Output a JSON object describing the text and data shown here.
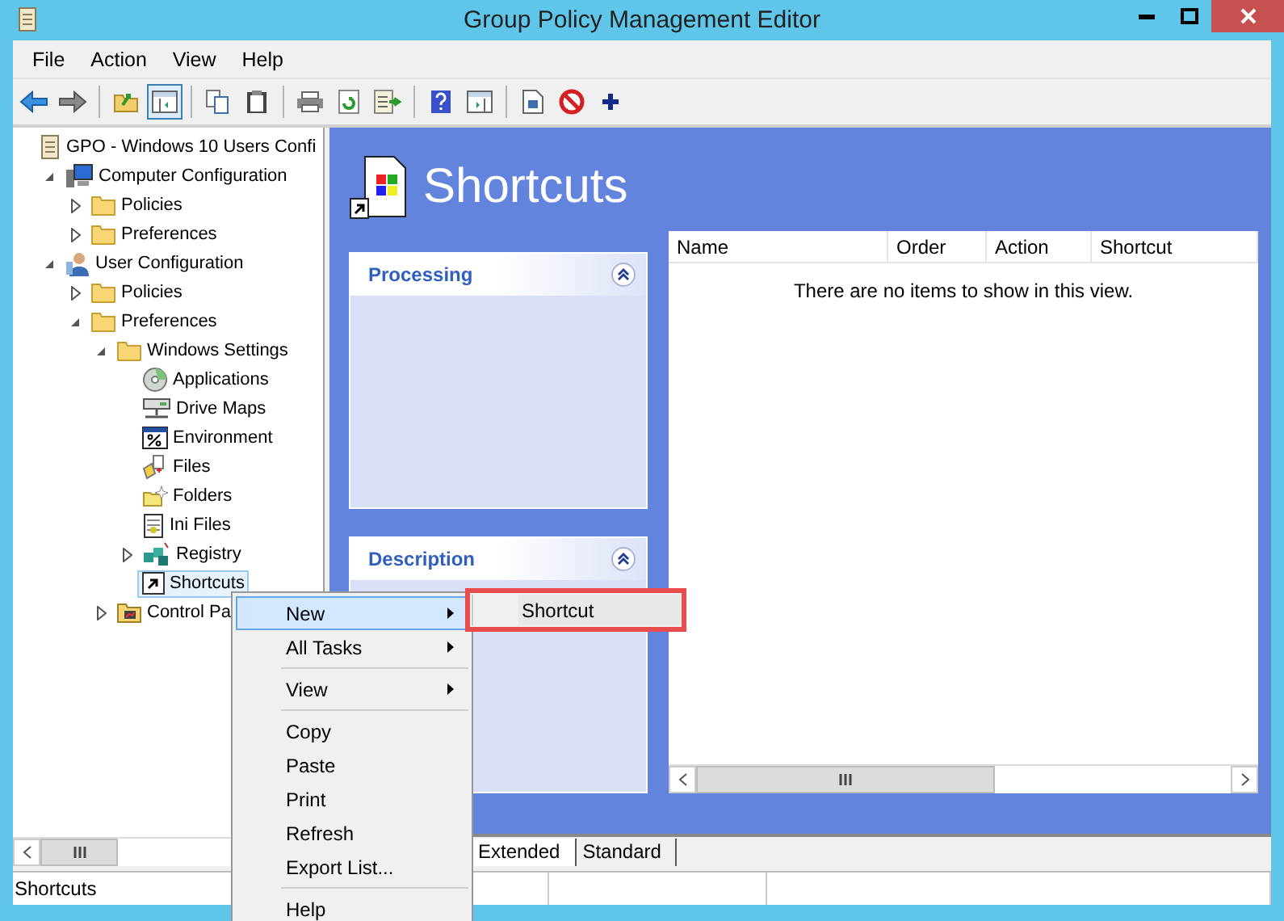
{
  "window": {
    "title": "Group Policy Management Editor"
  },
  "menu_bar": [
    "File",
    "Action",
    "View",
    "Help"
  ],
  "toolbar": [
    {
      "pressed": false
    },
    {
      "pressed": false
    },
    {
      "pressed": false
    },
    {
      "pressed": true
    },
    {
      "pressed": false
    },
    {
      "pressed": false
    },
    {
      "pressed": false
    },
    {
      "pressed": false
    },
    {
      "pressed": false
    },
    {
      "pressed": false
    },
    {
      "pressed": false
    },
    {
      "pressed": false
    },
    {
      "pressed": false
    },
    {
      "pressed": false
    }
  ],
  "tree": [
    {
      "label": "GPO - Windows 10 Users Confi",
      "kind": "gpo",
      "selected": false,
      "children": [
        {
          "label": "Computer Configuration",
          "kind": "computer",
          "selected": false,
          "expanded": true,
          "children": [
            {
              "label": "Policies",
              "kind": "folder",
              "selected": false,
              "expanded": false
            },
            {
              "label": "Preferences",
              "kind": "folder",
              "selected": false,
              "expanded": false
            }
          ]
        },
        {
          "label": "User Configuration",
          "kind": "user",
          "selected": false,
          "expanded": true,
          "children": [
            {
              "label": "Policies",
              "kind": "folder",
              "selected": false,
              "expanded": false
            },
            {
              "label": "Preferences",
              "kind": "folder",
              "selected": false,
              "expanded": true,
              "children": [
                {
                  "label": "Windows Settings",
                  "kind": "folder",
                  "selected": false,
                  "expanded": true,
                  "children": [
                    {
                      "label": "Applications",
                      "kind": "disc",
                      "selected": false
                    },
                    {
                      "label": "Drive Maps",
                      "kind": "drive",
                      "selected": false
                    },
                    {
                      "label": "Environment",
                      "kind": "env",
                      "selected": false
                    },
                    {
                      "label": "Files",
                      "kind": "files",
                      "selected": false
                    },
                    {
                      "label": "Folders",
                      "kind": "folders",
                      "selected": false
                    },
                    {
                      "label": "Ini Files",
                      "kind": "ini",
                      "selected": false
                    },
                    {
                      "label": "Registry",
                      "kind": "registry",
                      "selected": false,
                      "expanded": false
                    },
                    {
                      "label": "Shortcuts",
                      "kind": "shortcut",
                      "selected": true
                    }
                  ]
                },
                {
                  "label": "Control Pa",
                  "kind": "control",
                  "selected": false,
                  "expanded": false
                }
              ]
            }
          ]
        }
      ]
    }
  ],
  "header": {
    "title": "Shortcuts"
  },
  "panels": [
    {
      "title": "Processing",
      "expanded": true
    },
    {
      "title": "Description",
      "expanded": true
    }
  ],
  "list": {
    "columns": [
      "Name",
      "Order",
      "Action",
      "Shortcut"
    ],
    "empty_message": "There are no items to show in this view."
  },
  "view_tabs": [
    {
      "label": "Extended",
      "selected": true
    },
    {
      "label": "Standard",
      "selected": false
    }
  ],
  "status_bar": {
    "text": "Shortcuts"
  },
  "context_menu": [
    {
      "kind": "item",
      "label": "New",
      "submenu": true,
      "selected": true
    },
    {
      "kind": "item",
      "label": "All Tasks",
      "submenu": true,
      "selected": false
    },
    {
      "kind": "separator"
    },
    {
      "kind": "item",
      "label": "View",
      "submenu": true,
      "selected": false
    },
    {
      "kind": "separator"
    },
    {
      "kind": "item",
      "label": "Copy",
      "submenu": false,
      "selected": false
    },
    {
      "kind": "item",
      "label": "Paste",
      "submenu": false,
      "selected": false
    },
    {
      "kind": "item",
      "label": "Print",
      "submenu": false,
      "selected": false
    },
    {
      "kind": "item",
      "label": "Refresh",
      "submenu": false,
      "selected": false
    },
    {
      "kind": "item",
      "label": "Export List...",
      "submenu": false,
      "selected": false
    },
    {
      "kind": "separator"
    },
    {
      "kind": "item",
      "label": "Help",
      "submenu": false,
      "selected": false
    }
  ],
  "submenu": [
    {
      "label": "Shortcut",
      "highlighted": true
    }
  ]
}
